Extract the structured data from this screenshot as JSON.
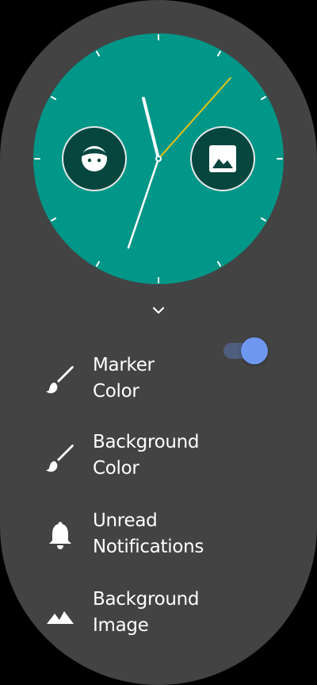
{
  "watch_face": {
    "dial_color": "#009688",
    "hour_hand_color": "#ffffff",
    "minute_hand_color": "#ffffff",
    "second_hand_color": "#e7c418",
    "left_complication": {
      "icon": "face-icon"
    },
    "right_complication": {
      "icon": "image-icon"
    }
  },
  "expand": {
    "icon": "chevron-down-icon"
  },
  "settings": {
    "marker_color": {
      "icon": "brush-icon",
      "line1": "Marker",
      "line2": "Color"
    },
    "background_color": {
      "icon": "brush-icon",
      "line1": "Background",
      "line2": "Color"
    },
    "unread_notifications": {
      "icon": "bell-icon",
      "line1": "Unread",
      "line2": "Notifications",
      "enabled": true
    },
    "background_image": {
      "icon": "landscape-icon",
      "line1": "Background",
      "line2": "Image"
    }
  },
  "colors": {
    "screen_bg": "#434343",
    "toggle_thumb": "#6e98f0",
    "toggle_track": "#4f5d7e"
  }
}
